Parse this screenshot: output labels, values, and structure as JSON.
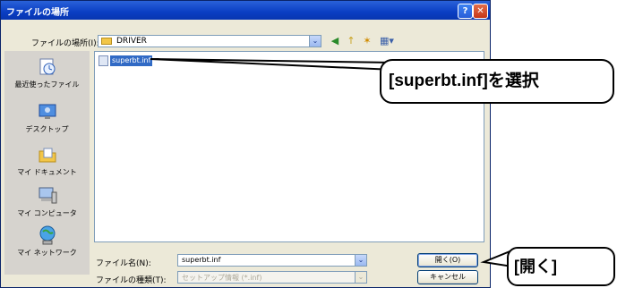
{
  "dialog": {
    "title": "ファイルの場所",
    "help_glyph": "?",
    "close_glyph": "✕"
  },
  "toolbar": {
    "lookin_label": "ファイルの場所(I):",
    "lookin_value": "DRIVER",
    "dropdown_glyph": "⌄",
    "back_glyph": "◀",
    "up_glyph": "↑",
    "newfolder_glyph": "✶",
    "view_glyph": "▦▾"
  },
  "places": [
    {
      "label": "最近使ったファイル",
      "icon": "recent-documents-icon"
    },
    {
      "label": "デスクトップ",
      "icon": "desktop-icon"
    },
    {
      "label": "マイ ドキュメント",
      "icon": "my-documents-icon"
    },
    {
      "label": "マイ コンピュータ",
      "icon": "my-computer-icon"
    },
    {
      "label": "マイ ネットワーク",
      "icon": "my-network-icon"
    }
  ],
  "files": [
    {
      "name": "superbt.inf",
      "selected": true
    }
  ],
  "filename": {
    "label": "ファイル名(N):",
    "value": "superbt.inf"
  },
  "filetype": {
    "label": "ファイルの種類(T):",
    "value": "セットアップ情報 (*.inf)"
  },
  "buttons": {
    "open": "開く(O)",
    "cancel": "キャンセル"
  },
  "callouts": {
    "select": "[superbt.inf]を選択",
    "open": "[開く]"
  },
  "colors": {
    "titlebar": "#0a3ec3",
    "selection": "#316ac5",
    "dialog_bg": "#ece9d8"
  }
}
